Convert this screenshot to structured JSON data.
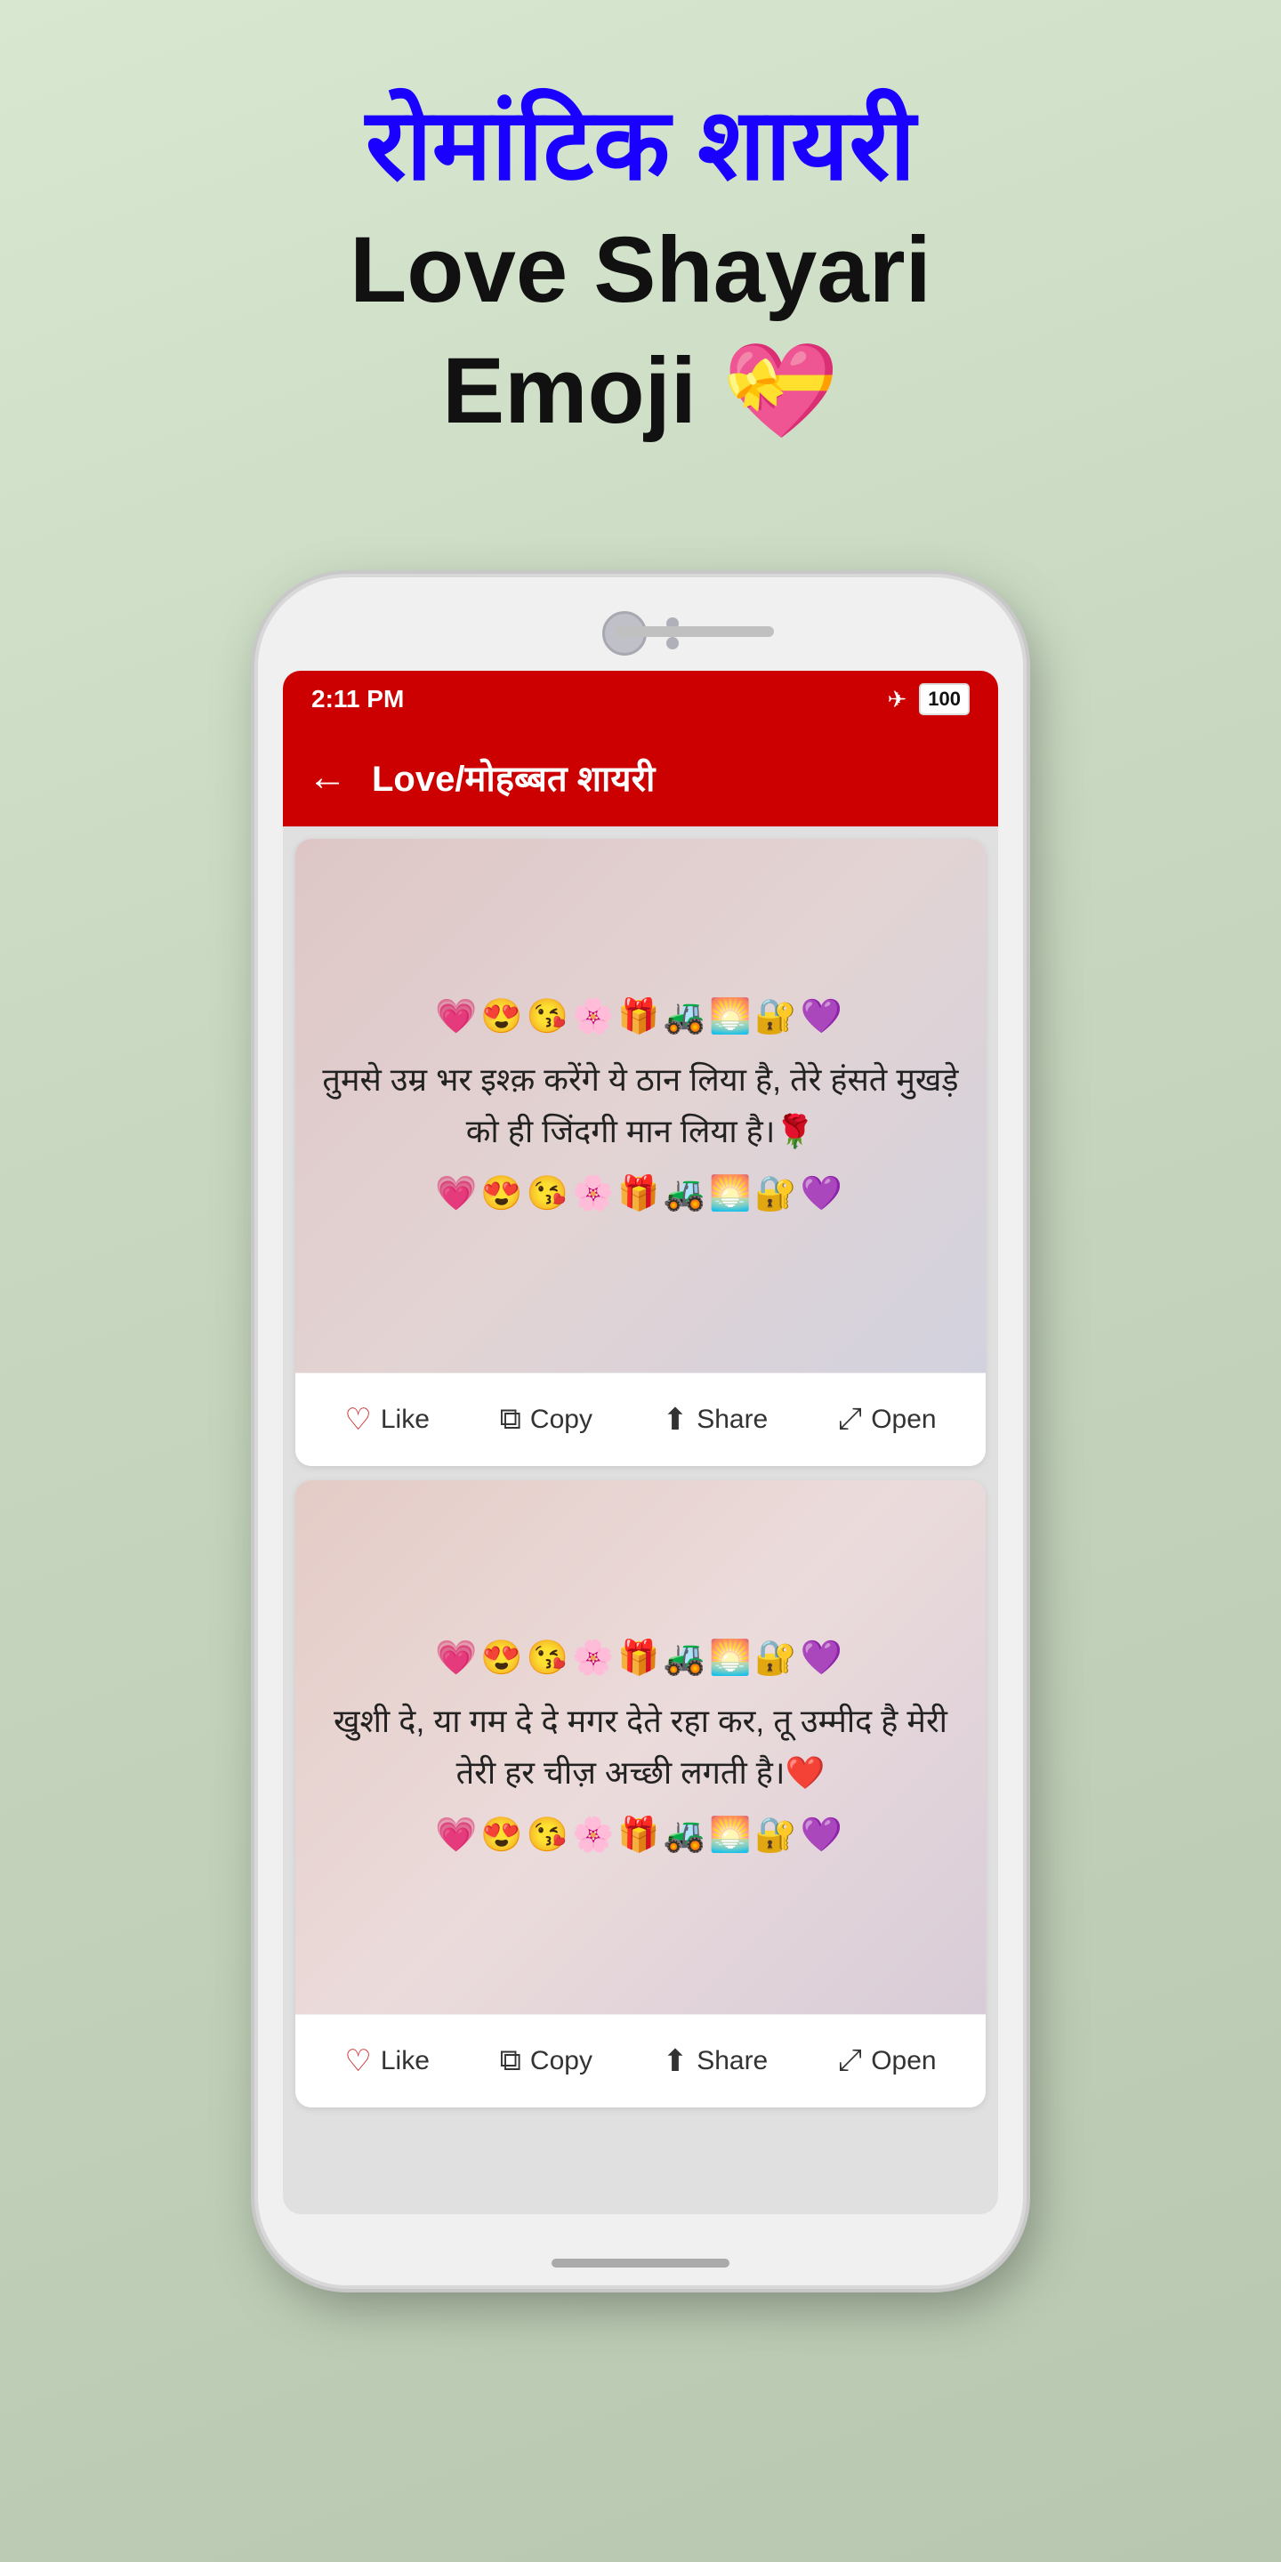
{
  "page": {
    "background": "#c8d8c0",
    "title_hindi": "रोमांटिक शायरी",
    "title_line2": "Love Shayari",
    "title_line3": "Emoji 💝",
    "emoji_decoration": "💝"
  },
  "phone": {
    "status_time": "2:11 PM",
    "battery": "100",
    "app_header_title": "Love/मोहब्बत शायरी"
  },
  "cards": [
    {
      "id": "card1",
      "emojis_top": "💗😍😘🌸🎁🚜🌅🔐💜",
      "text": "तुमसे उम्र भर इश्क़ करेंगे ये ठान लिया है,\nतेरे हंसते मुखड़े को ही जिंदगी मान लिया है।🌹",
      "emojis_bottom": "💗😍😘🌸🎁🚜🌅🔐💜",
      "like_label": "Like",
      "copy_label": "Copy",
      "share_label": "Share",
      "open_label": "Open"
    },
    {
      "id": "card2",
      "emojis_top": "💗😍😘🌸🎁🚜🌅🔐💜",
      "text": "खुशी दे, या गम दे दे मगर देते रहा कर,\nतू उम्मीद है मेरी तेरी हर चीज़ अच्छी लगती है।❤️",
      "emojis_bottom": "💗😍😘🌸🎁🚜🌅🔐💜",
      "like_label": "Like",
      "copy_label": "Copy",
      "share_label": "Share",
      "open_label": "Open"
    }
  ],
  "icons": {
    "back": "←",
    "like": "♡",
    "copy": "⧉",
    "share": "↗",
    "open": "⤢",
    "airplane": "✈",
    "battery_text": "100"
  }
}
